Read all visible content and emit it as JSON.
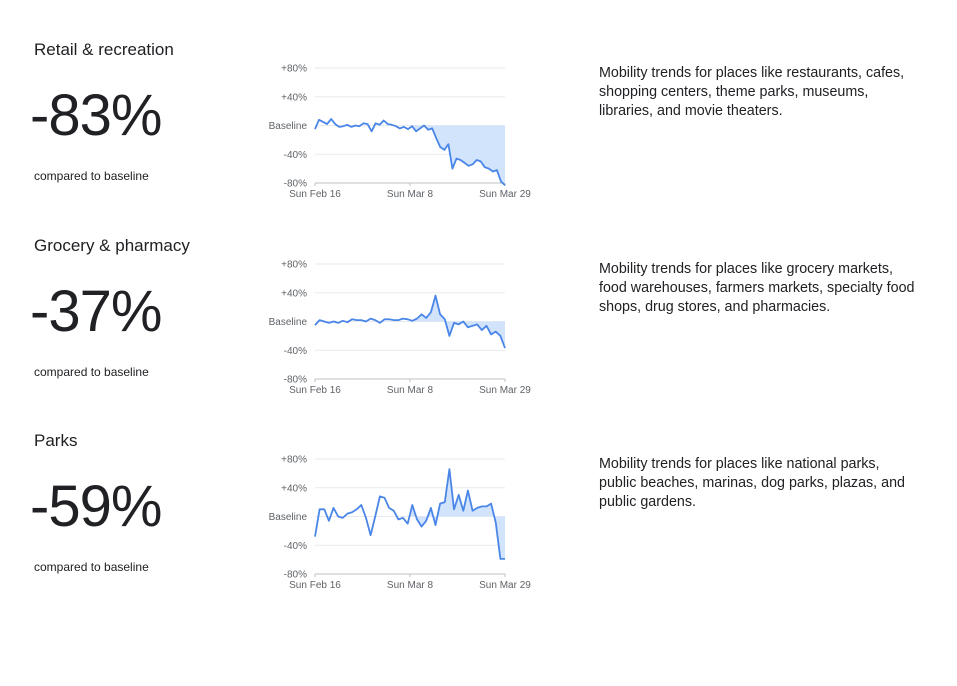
{
  "chart_data": [
    {
      "type": "area",
      "title": "Retail & recreation",
      "headline": "-83%",
      "caption": "compared to baseline",
      "description": "Mobility trends for places like restaurants, cafes, shopping centers, theme parks, museums, libraries, and movie theaters.",
      "x_tick_labels": [
        "Sun Feb 16",
        "Sun Mar 8",
        "Sun Mar 29"
      ],
      "y_tick_labels": [
        "+80%",
        "+40%",
        "Baseline",
        "-40%",
        "-80%"
      ],
      "ylim": [
        -80,
        80
      ],
      "x_start": "2020-02-16",
      "x_end": "2020-03-29",
      "shaded_from": "2020-03-08",
      "series": [
        {
          "values": [
            -5,
            8,
            5,
            2,
            9,
            2,
            -2,
            -1,
            1,
            -2,
            0,
            -1,
            3,
            2,
            -8,
            3,
            1,
            7,
            2,
            1,
            -1,
            -4,
            -2,
            -5,
            -1,
            -8,
            -4,
            0,
            -6,
            -4,
            -18,
            -30,
            -34,
            -26,
            -60,
            -46,
            -48,
            -52,
            -56,
            -54,
            -48,
            -50,
            -58,
            -60,
            -64,
            -62,
            -78,
            -83
          ],
          "x_end_index": 42
        }
      ]
    },
    {
      "type": "area",
      "title": "Grocery & pharmacy",
      "headline": "-37%",
      "caption": "compared to baseline",
      "description": "Mobility trends for places like grocery markets, food warehouses, farmers markets, specialty food shops, drug stores, and pharmacies.",
      "x_tick_labels": [
        "Sun Feb 16",
        "Sun Mar 8",
        "Sun Mar 29"
      ],
      "y_tick_labels": [
        "+80%",
        "+40%",
        "Baseline",
        "-40%",
        "-80%"
      ],
      "ylim": [
        -80,
        80
      ],
      "x_start": "2020-02-16",
      "x_end": "2020-03-29",
      "shaded_from": "2020-03-08",
      "series": [
        {
          "values": [
            -5,
            2,
            0,
            -2,
            0,
            -2,
            1,
            -1,
            3,
            2,
            2,
            0,
            4,
            2,
            -2,
            3,
            3,
            2,
            2,
            4,
            3,
            1,
            4,
            10,
            5,
            13,
            36,
            10,
            3,
            -20,
            -2,
            -4,
            0,
            -8,
            -6,
            -4,
            -12,
            -6,
            -18,
            -14,
            -20,
            -37
          ]
        }
      ]
    },
    {
      "type": "area",
      "title": "Parks",
      "headline": "-59%",
      "caption": "compared to baseline",
      "description": "Mobility trends for places like national parks, public beaches, marinas, dog parks, plazas, and public gardens.",
      "x_tick_labels": [
        "Sun Feb 16",
        "Sun Mar 8",
        "Sun Mar 29"
      ],
      "y_tick_labels": [
        "+80%",
        "+40%",
        "Baseline",
        "-40%",
        "-80%"
      ],
      "ylim": [
        -80,
        80
      ],
      "x_start": "2020-02-16",
      "x_end": "2020-03-29",
      "shaded_from": "2020-03-08",
      "series": [
        {
          "values": [
            -28,
            10,
            10,
            -6,
            12,
            0,
            -2,
            4,
            6,
            10,
            16,
            -2,
            -26,
            0,
            28,
            26,
            12,
            8,
            -4,
            -2,
            -10,
            16,
            -4,
            -14,
            -6,
            12,
            -12,
            18,
            20,
            66,
            10,
            30,
            8,
            36,
            8,
            12,
            14,
            14,
            18,
            -8,
            -59,
            -59
          ]
        }
      ]
    }
  ]
}
